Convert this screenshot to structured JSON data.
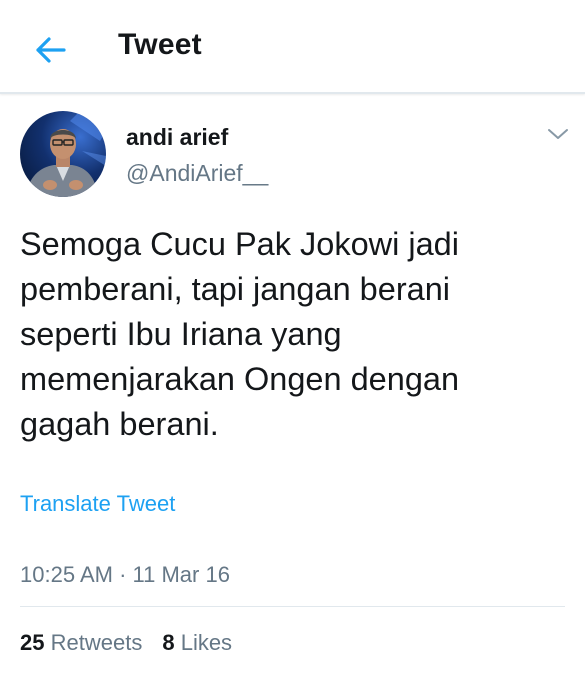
{
  "header": {
    "back_icon": "arrow-left-icon",
    "title": "Tweet"
  },
  "author": {
    "name": "andi arief",
    "handle": "@AndiArief__"
  },
  "tweet": {
    "text": "Semoga Cucu Pak Jokowi jadi\npemberani, tapi jangan berani\nseperti Ibu Iriana yang\nmemenjarakan Ongen dengan\ngagah berani.",
    "translate_label": "Translate Tweet",
    "time": "10:25 AM",
    "date": "11 Mar 16",
    "retweets": "25",
    "retweets_label": "Retweets",
    "likes": "8",
    "likes_label": "Likes"
  },
  "colors": {
    "accent": "#1da1f2",
    "text": "#14171a",
    "muted": "#657786",
    "divider": "#e1e8ed"
  }
}
